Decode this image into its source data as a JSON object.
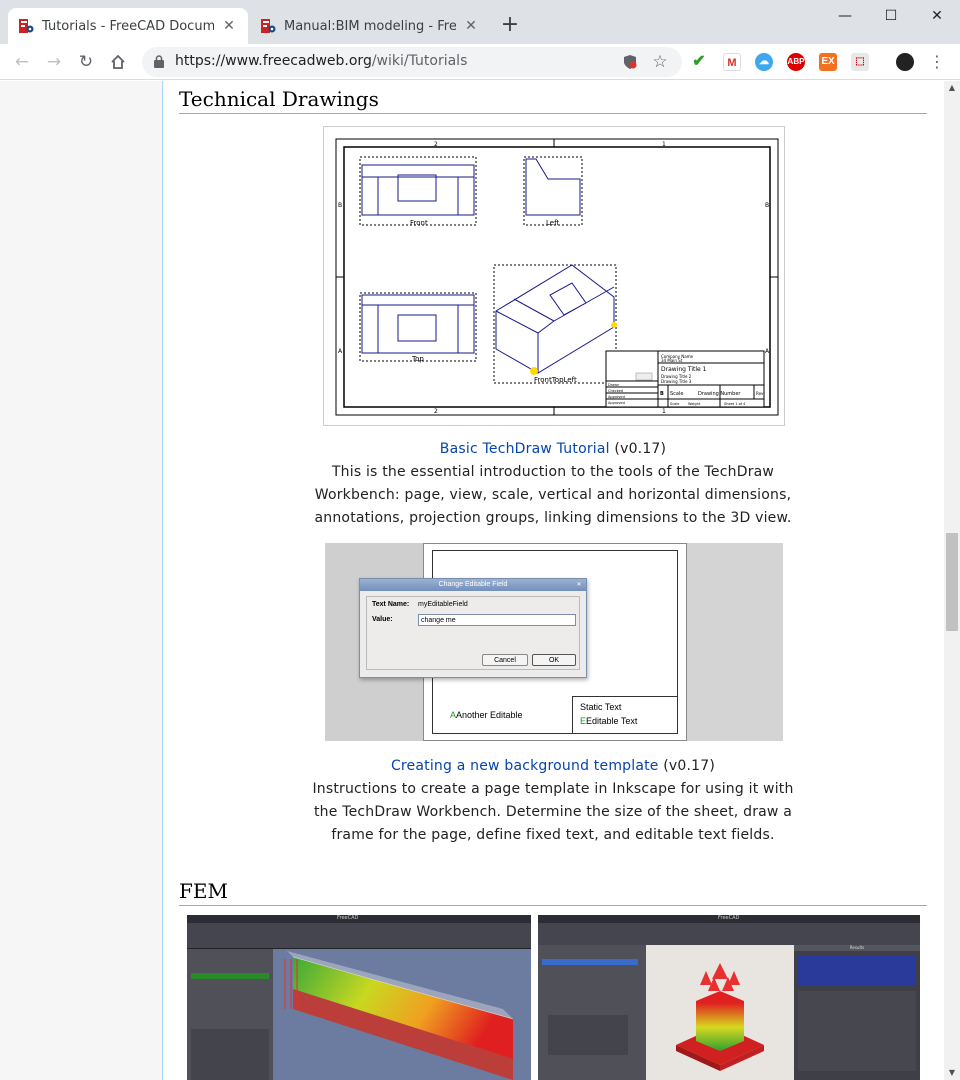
{
  "browser": {
    "tabs": [
      {
        "title": "Tutorials - FreeCAD Documentation",
        "active": true
      },
      {
        "title": "Manual:BIM modeling - FreeCAD Documentation",
        "active": false
      }
    ],
    "new_tab": "+",
    "url_host": "https://www.freecadweb.org",
    "url_path": "/wiki/Tutorials",
    "window": {
      "minimize": "—",
      "maximize": "☐",
      "close": "✕"
    }
  },
  "sections": {
    "technical_drawings": {
      "heading": "Technical Drawings",
      "items": [
        {
          "link": "Basic TechDraw Tutorial",
          "version": " (v0.17)",
          "description": "This is the essential introduction to the tools of the TechDraw Workbench: page, view, scale, vertical and horizontal dimensions, annotations, projection groups, linking dimensions to the 3D view."
        },
        {
          "link": "Creating a new background template",
          "version": " (v0.17)",
          "description": "Instructions to create a page template in Inkscape for using it with the TechDraw Workbench. Determine the size of the sheet, draw a frame for the page, define fixed text, and editable text fields."
        }
      ]
    },
    "fem": {
      "heading": "FEM"
    }
  },
  "drawing": {
    "zone_top": [
      "2",
      "1"
    ],
    "zone_side": [
      "B",
      "A"
    ],
    "view_labels": [
      "Front",
      "Left",
      "Top",
      "FrontTopLeft"
    ],
    "title_block": {
      "title": "Drawing Title 1",
      "size": "B",
      "scale": "Scale",
      "number": "Drawing Number",
      "company": "Company Name",
      "address": "34 Main St",
      "title2": "Drawing Title 2",
      "title3": "Drawing Title 3",
      "sheet": "Sheet 1 of 4",
      "weight": "Weight",
      "rev": "Rev",
      "rows": [
        "Drawn",
        "Checked",
        "Approved",
        "Approved"
      ]
    }
  },
  "dialog": {
    "title": "Change Editable Field",
    "name_label": "Text Name:",
    "name_value": "myEditableField",
    "value_label": "Value:",
    "value": "change me",
    "cancel": "Cancel",
    "ok": "OK",
    "template_texts": [
      "Another Editable",
      "Static Text",
      "Editable Text"
    ]
  },
  "fem_screens": {
    "left_app": "FreeCAD",
    "right_app": "FreeCAD",
    "panel_title": "Results"
  },
  "colors": {
    "link": "#0645ad",
    "accent_border": "#a7d7f9"
  }
}
